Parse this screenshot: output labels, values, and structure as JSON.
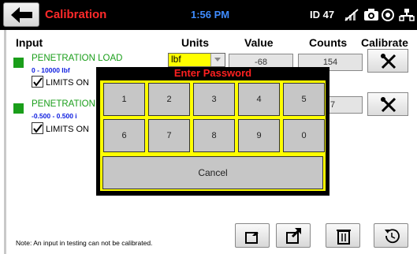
{
  "header": {
    "title": "Calibration",
    "time": "1:56 PM",
    "device_id": "ID 47",
    "icons": [
      "back-arrow-icon",
      "wifi-off-icon",
      "camera-icon",
      "settings-icon",
      "network-icon"
    ]
  },
  "columns": {
    "input": "Input",
    "units": "Units",
    "value": "Value",
    "counts": "Counts",
    "calibrate": "Calibrate"
  },
  "channels": [
    {
      "name": "PENETRATION LOAD",
      "range": "0 - 10000 lbf",
      "limits_label": "LIMITS ON",
      "units": "lbf",
      "value": "-68",
      "counts": "154",
      "status_color": "#1a9e1a"
    },
    {
      "name": "PENETRATION",
      "range": "-0.500 - 0.500 i",
      "limits_label": "LIMITS ON",
      "counts": "7",
      "status_color": "#1a9e1a"
    }
  ],
  "dialog": {
    "title": "Enter Password",
    "keys": [
      "1",
      "2",
      "3",
      "4",
      "5",
      "6",
      "7",
      "8",
      "9",
      "0"
    ],
    "cancel": "Cancel"
  },
  "footer": {
    "note": "Note:  An input in testing can not be calibrated.",
    "buttons": [
      "import-icon",
      "export-icon",
      "delete-icon",
      "reset-icon"
    ]
  },
  "colors": {
    "title_red": "#ff2a2a",
    "clock_blue": "#3f8cff",
    "status_green": "#1a9e1a",
    "range_blue": "#1020e0",
    "keypad_yellow": "#ffff00"
  }
}
